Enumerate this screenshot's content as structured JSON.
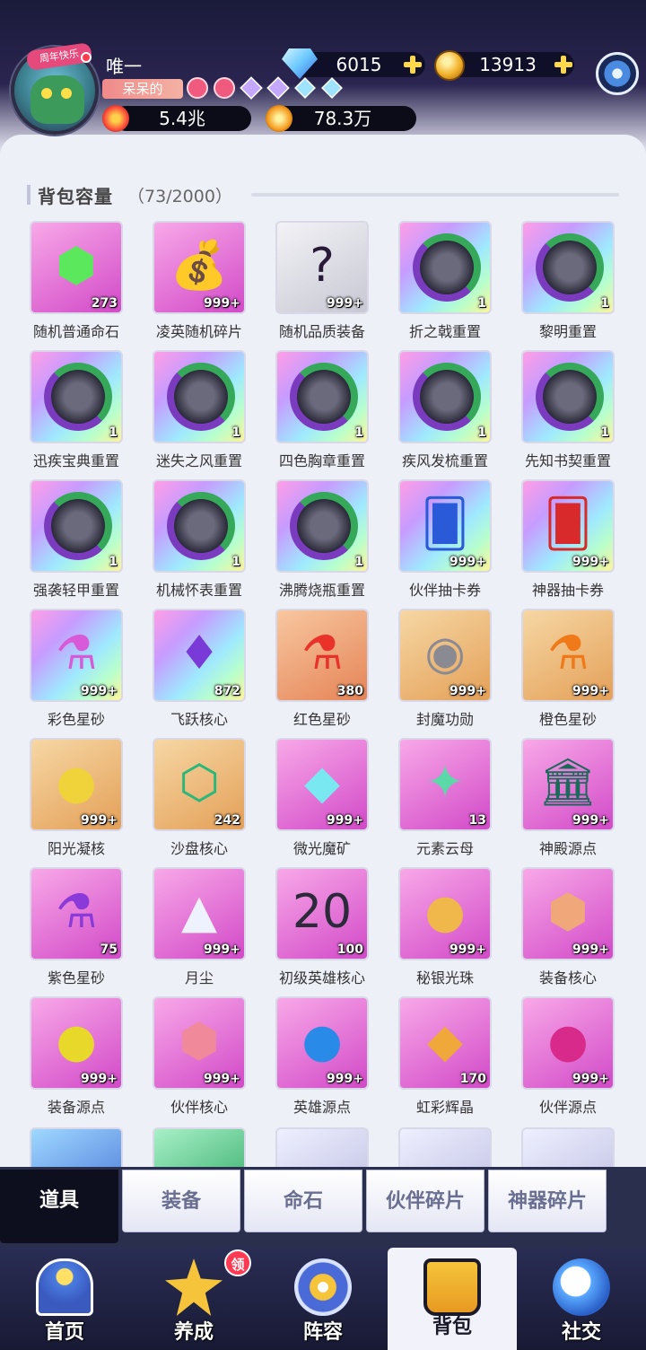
{
  "player": {
    "name": "唯一",
    "tag": "呆呆的",
    "avatar_banner": "周年快乐",
    "power": "5.4兆",
    "gold2": "78.3万"
  },
  "currency": {
    "gems": "6015",
    "coins": "13913"
  },
  "bag": {
    "title": "背包容量",
    "count": "（73/2000）"
  },
  "items": [
    {
      "label": "随机普通命石",
      "count": "273",
      "tile": "pink",
      "glyph": "⬢",
      "glyph_color": "#5ce85c"
    },
    {
      "label": "凌英随机碎片",
      "count": "999+",
      "tile": "pink",
      "glyph": "💰",
      "glyph_color": "#3aa84a"
    },
    {
      "label": "随机品质装备",
      "count": "999+",
      "tile": "gray",
      "glyph": "?",
      "glyph_color": "#2a1a3a"
    },
    {
      "label": "折之戟重置",
      "count": "1",
      "tile": "rainbow",
      "ring": true
    },
    {
      "label": "黎明重置",
      "count": "1",
      "tile": "rainbow",
      "ring": true
    },
    {
      "label": "迅疾宝典重置",
      "count": "1",
      "tile": "rainbow",
      "ring": true
    },
    {
      "label": "迷失之风重置",
      "count": "1",
      "tile": "rainbow",
      "ring": true
    },
    {
      "label": "四色胸章重置",
      "count": "1",
      "tile": "rainbow",
      "ring": true
    },
    {
      "label": "疾风发梳重置",
      "count": "1",
      "tile": "rainbow",
      "ring": true
    },
    {
      "label": "先知书契重置",
      "count": "1",
      "tile": "rainbow",
      "ring": true
    },
    {
      "label": "强袭轻甲重置",
      "count": "1",
      "tile": "rainbow",
      "ring": true
    },
    {
      "label": "机械怀表重置",
      "count": "1",
      "tile": "rainbow",
      "ring": true
    },
    {
      "label": "沸腾烧瓶重置",
      "count": "1",
      "tile": "rainbow",
      "ring": true
    },
    {
      "label": "伙伴抽卡券",
      "count": "999+",
      "tile": "rainbow",
      "glyph": "🂠",
      "glyph_color": "#2a5ad8"
    },
    {
      "label": "神器抽卡券",
      "count": "999+",
      "tile": "rainbow",
      "glyph": "🂠",
      "glyph_color": "#d82a2a"
    },
    {
      "label": "彩色星砂",
      "count": "999+",
      "tile": "rainbow",
      "glyph": "⚗",
      "glyph_color": "#d85ad8"
    },
    {
      "label": "飞跃核心",
      "count": "872",
      "tile": "rainbow",
      "glyph": "♦",
      "glyph_color": "#7a3ad8"
    },
    {
      "label": "红色星砂",
      "count": "380",
      "tile": "orange",
      "glyph": "⚗",
      "glyph_color": "#e8322a"
    },
    {
      "label": "封魔功勋",
      "count": "999+",
      "tile": "gold",
      "glyph": "◉",
      "glyph_color": "#8a8a92"
    },
    {
      "label": "橙色星砂",
      "count": "999+",
      "tile": "gold",
      "glyph": "⚗",
      "glyph_color": "#f07a1a"
    },
    {
      "label": "阳光凝核",
      "count": "999+",
      "tile": "gold",
      "glyph": "●",
      "glyph_color": "#f0d23a"
    },
    {
      "label": "沙盘核心",
      "count": "242",
      "tile": "gold",
      "glyph": "⬡",
      "glyph_color": "#2ab87a"
    },
    {
      "label": "微光魔矿",
      "count": "999+",
      "tile": "pink",
      "glyph": "◆",
      "glyph_color": "#7ae8f0"
    },
    {
      "label": "元素云母",
      "count": "13",
      "tile": "pink",
      "glyph": "✦",
      "glyph_color": "#5ad8a8"
    },
    {
      "label": "神殿源点",
      "count": "999+",
      "tile": "pink",
      "glyph": "🏛",
      "glyph_color": "#1a6a5a"
    },
    {
      "label": "紫色星砂",
      "count": "75",
      "tile": "pink",
      "glyph": "⚗",
      "glyph_color": "#8a3ad8"
    },
    {
      "label": "月尘",
      "count": "999+",
      "tile": "pink",
      "glyph": "▲",
      "glyph_color": "#eef2ff"
    },
    {
      "label": "初级英雄核心",
      "count": "100",
      "tile": "pink",
      "glyph": "20",
      "glyph_color": "#2a2a3a"
    },
    {
      "label": "秘银光珠",
      "count": "999+",
      "tile": "pink",
      "glyph": "●",
      "glyph_color": "#f0b84a"
    },
    {
      "label": "装备核心",
      "count": "999+",
      "tile": "pink",
      "glyph": "⬢",
      "glyph_color": "#f0a87a"
    },
    {
      "label": "装备源点",
      "count": "999+",
      "tile": "pink",
      "glyph": "●",
      "glyph_color": "#e8d82a"
    },
    {
      "label": "伙伴核心",
      "count": "999+",
      "tile": "pink",
      "glyph": "⬢",
      "glyph_color": "#f08a9a"
    },
    {
      "label": "英雄源点",
      "count": "999+",
      "tile": "pink",
      "glyph": "●",
      "glyph_color": "#2a8ae8"
    },
    {
      "label": "虹彩辉晶",
      "count": "170",
      "tile": "pink",
      "glyph": "◆",
      "glyph_color": "#f0a83a"
    },
    {
      "label": "伙伴源点",
      "count": "999+",
      "tile": "pink",
      "glyph": "●",
      "glyph_color": "#d82a8a"
    }
  ],
  "tabs": [
    {
      "label": "道具",
      "active": true
    },
    {
      "label": "装备",
      "active": false
    },
    {
      "label": "命石",
      "active": false
    },
    {
      "label": "伙伴碎片",
      "active": false
    },
    {
      "label": "神器碎片",
      "active": false
    }
  ],
  "nav": [
    {
      "label": "首页",
      "icon": "home-icon",
      "active": false
    },
    {
      "label": "养成",
      "icon": "star-icon",
      "active": false
    },
    {
      "label": "阵容",
      "icon": "lineup-icon",
      "active": false
    },
    {
      "label": "背包",
      "icon": "bag-icon",
      "active": true
    },
    {
      "label": "社交",
      "icon": "social-icon",
      "active": false
    }
  ],
  "nav_badge": "领",
  "colors": {
    "accent": "#d24ac8",
    "gold": "#ffd84a"
  }
}
